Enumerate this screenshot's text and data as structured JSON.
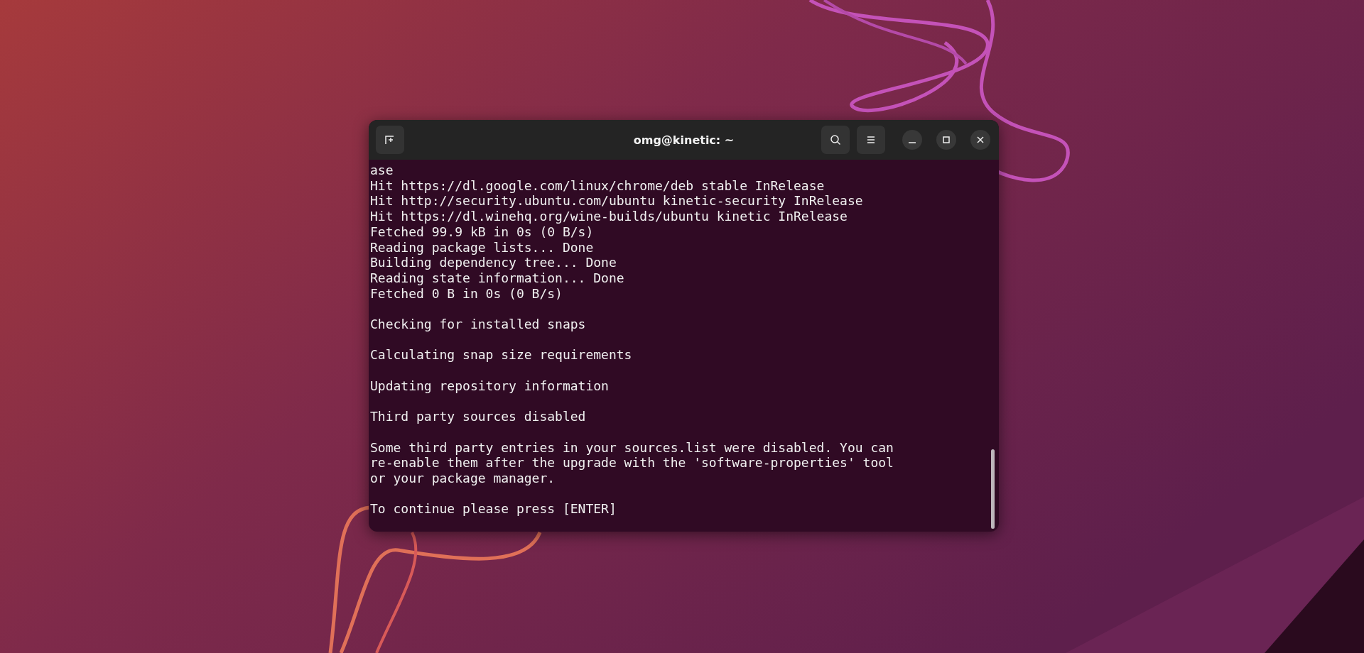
{
  "window": {
    "title": "omg@kinetic: ~"
  },
  "terminal": {
    "blocks": [
      [
        "ase",
        "Hit https://dl.google.com/linux/chrome/deb stable InRelease",
        "Hit http://security.ubuntu.com/ubuntu kinetic-security InRelease",
        "Hit https://dl.winehq.org/wine-builds/ubuntu kinetic InRelease",
        "Fetched 99.9 kB in 0s (0 B/s)",
        "Reading package lists... Done",
        "Building dependency tree... Done",
        "Reading state information... Done",
        "Fetched 0 B in 0s (0 B/s)"
      ],
      [
        "Checking for installed snaps"
      ],
      [
        "Calculating snap size requirements"
      ],
      [
        "Updating repository information"
      ],
      [
        "Third party sources disabled"
      ],
      [
        "Some third party entries in your sources.list were disabled. You can",
        "re-enable them after the upgrade with the 'software-properties' tool",
        "or your package manager."
      ],
      [
        "To continue please press [ENTER]"
      ]
    ]
  }
}
